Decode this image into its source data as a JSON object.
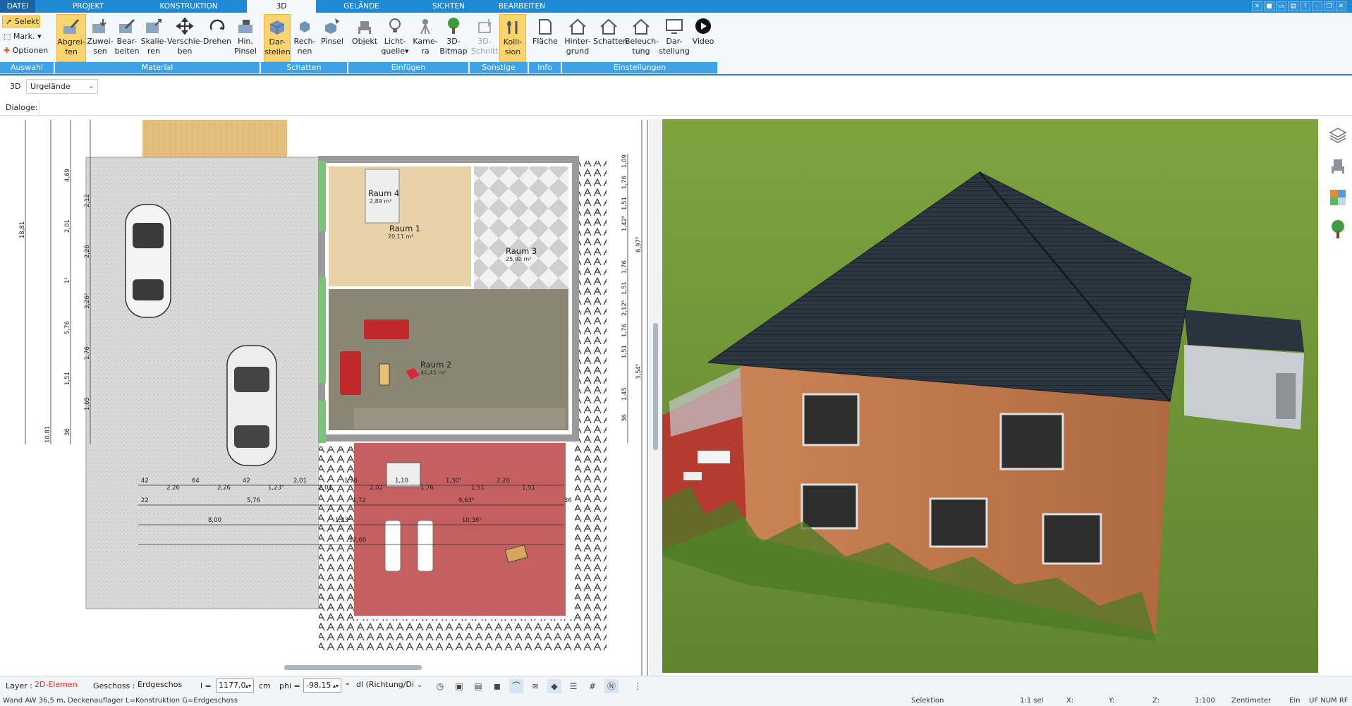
{
  "tabs": [
    "DATEI",
    "PROJEKT",
    "KONSTRUKTION",
    "3D",
    "GELÄNDE",
    "SICHTEN",
    "BEARBEITEN"
  ],
  "ribbon": {
    "selekt": "Selekt",
    "mark": "Mark.",
    "optionen": "Optionen",
    "buttons": [
      {
        "l1": "Abgrei-",
        "l2": "fen"
      },
      {
        "l1": "Zuwei-",
        "l2": "sen"
      },
      {
        "l1": "Bear-",
        "l2": "beiten"
      },
      {
        "l1": "Skalie-",
        "l2": "ren"
      },
      {
        "l1": "Verschie-",
        "l2": "ben"
      },
      {
        "l1": "Drehen",
        "l2": ""
      },
      {
        "l1": "Hin.",
        "l2": "Pinsel"
      },
      {
        "l1": "Dar-",
        "l2": "stellen"
      },
      {
        "l1": "Rech-",
        "l2": "nen"
      },
      {
        "l1": "Pinsel",
        "l2": ""
      },
      {
        "l1": "Objekt",
        "l2": ""
      },
      {
        "l1": "Licht-",
        "l2": "quelle"
      },
      {
        "l1": "Kame-",
        "l2": "ra"
      },
      {
        "l1": "3D-",
        "l2": "Bitmap"
      },
      {
        "l1": "3D-",
        "l2": "Schnitt"
      },
      {
        "l1": "Kolli-",
        "l2": "sion"
      },
      {
        "l1": "Fläche",
        "l2": ""
      },
      {
        "l1": "Hinter-",
        "l2": "grund"
      },
      {
        "l1": "Schatten",
        "l2": ""
      },
      {
        "l1": "Beleuch-",
        "l2": "tung"
      },
      {
        "l1": "Dar-",
        "l2": "stellung"
      },
      {
        "l1": "Video",
        "l2": ""
      }
    ],
    "groups": [
      "Auswahl",
      "Material",
      "Schatten",
      "Einfügen",
      "Sonstige",
      "Info",
      "Einstellungen"
    ]
  },
  "toolbar2": {
    "mode": "3D",
    "layer": "Urgelände"
  },
  "dialoge_label": "Dialoge:",
  "plan": {
    "rooms": [
      {
        "name": "Raum 4",
        "area": "2,89 m²"
      },
      {
        "name": "Raum 1",
        "area": "20,11 m²"
      },
      {
        "name": "Raum 3",
        "area": "25,90 m²"
      },
      {
        "name": "Raum 2",
        "area": "46,45 m²"
      }
    ],
    "dims_left_vertical": [
      "18,81",
      "10,81",
      "4,69",
      "2,12",
      "2,01",
      "2,26",
      "1¹",
      "3,26⁵",
      "5,76",
      "1,76",
      "1,51",
      "1,65",
      "36"
    ],
    "dims_right_vertical": [
      "1,09",
      "1,76",
      "1,51",
      "1,42⁵",
      "6,97⁵",
      "1,76",
      "1,51",
      "2,12⁵",
      "1,76",
      "1,51",
      "3,54⁵",
      "1,45",
      "36"
    ],
    "dims_bottom_row1": [
      "42",
      "2,26",
      "64",
      "2,26",
      "42",
      "1,23⁵",
      "2,01",
      "2,01",
      "1,76",
      "2,02",
      "1,10",
      "1,76",
      "1,30⁵",
      "1,51",
      "2,20",
      "1,51"
    ],
    "dims_bottom_row2": [
      "22",
      "5,76",
      "1,72",
      "9,63⁵",
      "36"
    ],
    "dims_bottom_row3": [
      "8,00",
      "1,23⁵",
      "10,36⁵"
    ],
    "dims_bottom_row4": [
      "17,60"
    ]
  },
  "bottom": {
    "layer_label": "Layer :",
    "layer_value": "2D-Elemen",
    "geschoss_label": "Geschoss :",
    "geschoss_value": "Erdgeschos",
    "l_label": "l =",
    "l_value": "1177,0",
    "unit": "cm",
    "phi_label": "phi =",
    "phi_value": "-98,15",
    "deg": "°",
    "dl_value": "dl (Richtung/Di"
  },
  "status": {
    "left": "Wand AW 36,5 m, Deckenauflager L=Konstruktion G=Erdgeschoss",
    "selektion": "Selektion",
    "sel": "1:1 sel",
    "x": "X:",
    "y": "Y:",
    "z": "Z:",
    "scale": "1:100",
    "unit": "Zentimeter",
    "ein": "Ein",
    "flags": "UF NUM RF"
  },
  "colors": {
    "accent": "#1e8ad6",
    "highlight": "#f9d46f",
    "group": "#3ea3e6",
    "paving": "#e0e0e0",
    "terrace": "#b44a4a",
    "lawn": "#6b8e3a",
    "roof": "#2a3440",
    "wall": "#c2794d"
  },
  "icons": [
    "cursor-icon",
    "mark-icon",
    "plus-icon",
    "eyedropper-icon",
    "assign-icon",
    "edit-icon",
    "scale-icon",
    "move-icon",
    "rotate-icon",
    "brush-icon",
    "render-icon",
    "object-icon",
    "light-icon",
    "camera-icon",
    "tree-icon",
    "cut-icon",
    "collision-icon",
    "area-icon",
    "background-icon",
    "shadow-icon",
    "lighting-icon",
    "display-icon",
    "video-icon",
    "layers-icon",
    "chair-icon",
    "texture-icon",
    "plant-icon"
  ]
}
